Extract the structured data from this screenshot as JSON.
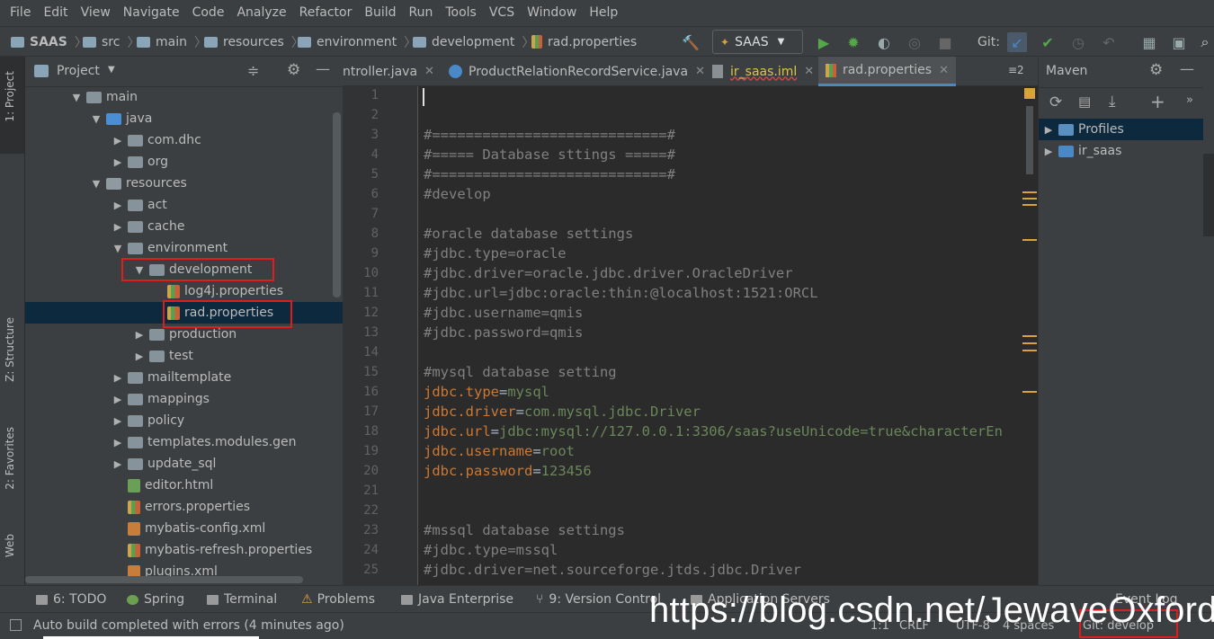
{
  "menu": [
    "File",
    "Edit",
    "View",
    "Navigate",
    "Code",
    "Analyze",
    "Refactor",
    "Build",
    "Run",
    "Tools",
    "VCS",
    "Window",
    "Help"
  ],
  "breadcrumb": [
    "SAAS",
    "src",
    "main",
    "resources",
    "environment",
    "development",
    "rad.properties"
  ],
  "toolbar": {
    "run_config": "SAAS",
    "git_label": "Git:"
  },
  "left_stripe": {
    "project": "1: Project",
    "structure": "Z: Structure",
    "favorites": "2: Favorites",
    "web": "Web"
  },
  "project_panel": {
    "title": "Project",
    "tree": [
      {
        "label": "main",
        "arrow": "▼",
        "icon": "dir"
      },
      {
        "label": "java",
        "arrow": "▼",
        "icon": "src"
      },
      {
        "label": "com.dhc",
        "arrow": "▶",
        "icon": "dir"
      },
      {
        "label": "org",
        "arrow": "▶",
        "icon": "dir"
      },
      {
        "label": "resources",
        "arrow": "▼",
        "icon": "res"
      },
      {
        "label": "act",
        "arrow": "▶",
        "icon": "dir"
      },
      {
        "label": "cache",
        "arrow": "▶",
        "icon": "dir"
      },
      {
        "label": "environment",
        "arrow": "▼",
        "icon": "dir"
      },
      {
        "label": "development",
        "arrow": "▼",
        "icon": "dir"
      },
      {
        "label": "log4j.properties",
        "arrow": "",
        "icon": "prop"
      },
      {
        "label": "rad.properties",
        "arrow": "",
        "icon": "prop"
      },
      {
        "label": "production",
        "arrow": "▶",
        "icon": "dir"
      },
      {
        "label": "test",
        "arrow": "▶",
        "icon": "dir"
      },
      {
        "label": "mailtemplate",
        "arrow": "▶",
        "icon": "dir"
      },
      {
        "label": "mappings",
        "arrow": "▶",
        "icon": "dir"
      },
      {
        "label": "policy",
        "arrow": "▶",
        "icon": "dir"
      },
      {
        "label": "templates.modules.gen",
        "arrow": "▶",
        "icon": "dir"
      },
      {
        "label": "update_sql",
        "arrow": "▶",
        "icon": "dir"
      },
      {
        "label": "editor.html",
        "arrow": "",
        "icon": "html"
      },
      {
        "label": "errors.properties",
        "arrow": "",
        "icon": "prop"
      },
      {
        "label": "mybatis-config.xml",
        "arrow": "",
        "icon": "xml"
      },
      {
        "label": "mybatis-refresh.properties",
        "arrow": "",
        "icon": "prop"
      },
      {
        "label": "plugins.xml",
        "arrow": "",
        "icon": "xml"
      }
    ]
  },
  "editor_tabs": [
    {
      "label": "ntroller.java"
    },
    {
      "label": "ProductRelationRecordService.java"
    },
    {
      "label": "ir_saas.iml"
    },
    {
      "label": "rad.properties"
    }
  ],
  "tab_overflow": "≡2",
  "editor": {
    "lines": [
      [],
      [],
      [
        {
          "t": "#============================#",
          "c": "com"
        }
      ],
      [
        {
          "t": "#===== Database sttings =====#",
          "c": "com"
        }
      ],
      [
        {
          "t": "#============================#",
          "c": "com"
        }
      ],
      [
        {
          "t": "#develop",
          "c": "com"
        }
      ],
      [],
      [
        {
          "t": "#oracle database settings",
          "c": "com"
        }
      ],
      [
        {
          "t": "#jdbc.type=oracle",
          "c": "com"
        }
      ],
      [
        {
          "t": "#jdbc.driver=oracle.jdbc.driver.OracleDriver",
          "c": "com"
        }
      ],
      [
        {
          "t": "#jdbc.url=jdbc:oracle:thin:@localhost:1521:ORCL",
          "c": "com"
        }
      ],
      [
        {
          "t": "#jdbc.username=qmis",
          "c": "com"
        }
      ],
      [
        {
          "t": "#jdbc.password=qmis",
          "c": "com"
        }
      ],
      [],
      [
        {
          "t": "#mysql database setting",
          "c": "com"
        }
      ],
      [
        {
          "t": "jdbc.type",
          "c": "key"
        },
        {
          "t": "=",
          "c": "eq"
        },
        {
          "t": "mysql",
          "c": "val"
        }
      ],
      [
        {
          "t": "jdbc.driver",
          "c": "key"
        },
        {
          "t": "=",
          "c": "eq"
        },
        {
          "t": "com.mysql.jdbc.Driver",
          "c": "val"
        }
      ],
      [
        {
          "t": "jdbc.url",
          "c": "key"
        },
        {
          "t": "=",
          "c": "eq"
        },
        {
          "t": "jdbc:mysql://127.0.0.1:3306/saas?useUnicode=true&characterEn",
          "c": "val"
        }
      ],
      [
        {
          "t": "jdbc.username",
          "c": "key"
        },
        {
          "t": "=",
          "c": "eq"
        },
        {
          "t": "root",
          "c": "val"
        }
      ],
      [
        {
          "t": "jdbc.password",
          "c": "key"
        },
        {
          "t": "=",
          "c": "eq"
        },
        {
          "t": "123456",
          "c": "val"
        }
      ],
      [],
      [],
      [
        {
          "t": "#mssql database settings",
          "c": "com"
        }
      ],
      [
        {
          "t": "#jdbc.type=mssql",
          "c": "com"
        }
      ],
      [
        {
          "t": "#jdbc.driver=net.sourceforge.jtds.jdbc.Driver",
          "c": "com"
        }
      ]
    ]
  },
  "maven": {
    "title": "Maven",
    "tree": [
      {
        "label": "Profiles",
        "arrow": "▶"
      },
      {
        "label": "ir_saas",
        "arrow": "▶"
      }
    ]
  },
  "bottom_tabs": [
    "6: TODO",
    "Spring",
    "Terminal",
    "Problems",
    "Java Enterprise",
    "9: Version Control",
    "Application Servers",
    "Event Log"
  ],
  "status": {
    "message": "Auto build completed with errors (4 minutes ago)",
    "position": "1:1",
    "line_sep": "CRLF",
    "encoding": "UTF-8",
    "indent": "4 spaces",
    "branch": "Git: develop"
  },
  "watermark": "https://blog.csdn.net/JewaveOxford",
  "colors": {
    "accent": "#4a88c7",
    "highlight_box": "#e01d1d",
    "key": "#cc7832",
    "value": "#6a8759",
    "comment": "#808080"
  }
}
